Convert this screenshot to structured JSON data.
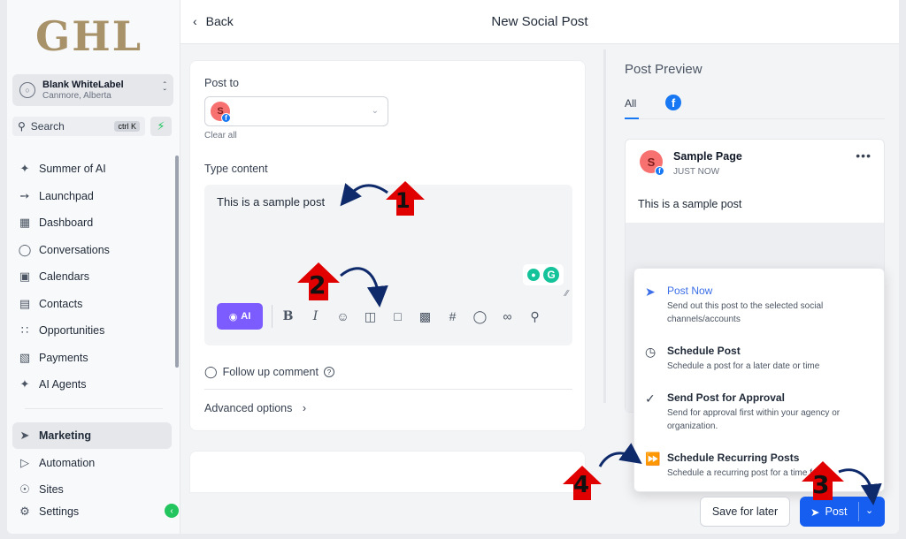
{
  "brand": {
    "logo_text": "GHL"
  },
  "account": {
    "name": "Blank WhiteLabel",
    "location": "Canmore, Alberta"
  },
  "search": {
    "label": "Search",
    "shortcut": "ctrl K"
  },
  "sidebar": {
    "items": [
      {
        "label": "Summer of AI",
        "icon": "sparkle-icon"
      },
      {
        "label": "Launchpad",
        "icon": "rocket-icon"
      },
      {
        "label": "Dashboard",
        "icon": "grid-icon"
      },
      {
        "label": "Conversations",
        "icon": "chat-icon"
      },
      {
        "label": "Calendars",
        "icon": "calendar-icon"
      },
      {
        "label": "Contacts",
        "icon": "contacts-icon"
      },
      {
        "label": "Opportunities",
        "icon": "nodes-icon"
      },
      {
        "label": "Payments",
        "icon": "receipt-icon"
      },
      {
        "label": "AI Agents",
        "icon": "sparkle-icon"
      }
    ],
    "bottom_items": [
      {
        "label": "Marketing",
        "icon": "send-icon",
        "active": true
      },
      {
        "label": "Automation",
        "icon": "play-icon"
      },
      {
        "label": "Sites",
        "icon": "globe-icon"
      },
      {
        "label": "Settings",
        "icon": "gear-icon"
      }
    ]
  },
  "header": {
    "back_label": "Back",
    "title": "New Social Post"
  },
  "editor": {
    "post_to_label": "Post to",
    "avatar_letter": "S",
    "clear_all": "Clear all",
    "type_content_label": "Type content",
    "content_value": "This is a sample post",
    "ai_label": "AI",
    "follow_up_label": "Follow up comment",
    "advanced_label": "Advanced options"
  },
  "preview": {
    "title": "Post Preview",
    "tab_all": "All",
    "page_name": "Sample Page",
    "time": "JUST NOW",
    "text": "This is a sample post"
  },
  "menu": {
    "items": [
      {
        "title": "Post Now",
        "desc": "Send out this post to the selected social channels/accounts",
        "icon": "send-icon"
      },
      {
        "title": "Schedule Post",
        "desc": "Schedule a post for a later date or time",
        "icon": "clock-icon"
      },
      {
        "title": "Send Post for Approval",
        "desc": "Send for approval first within your agency or organization.",
        "icon": "approval-icon"
      },
      {
        "title": "Schedule Recurring Posts",
        "desc": "Schedule a recurring post for a time frame",
        "icon": "recurring-icon"
      }
    ]
  },
  "footer": {
    "save_label": "Save for later",
    "post_label": "Post"
  },
  "annotations": {
    "n1": "1",
    "n2": "2",
    "n3": "3",
    "n4": "4"
  },
  "colors": {
    "accent": "#155eef",
    "ai_button": "#7c5cff",
    "annotation": "#e00000",
    "arrow": "#0f2a6b"
  }
}
